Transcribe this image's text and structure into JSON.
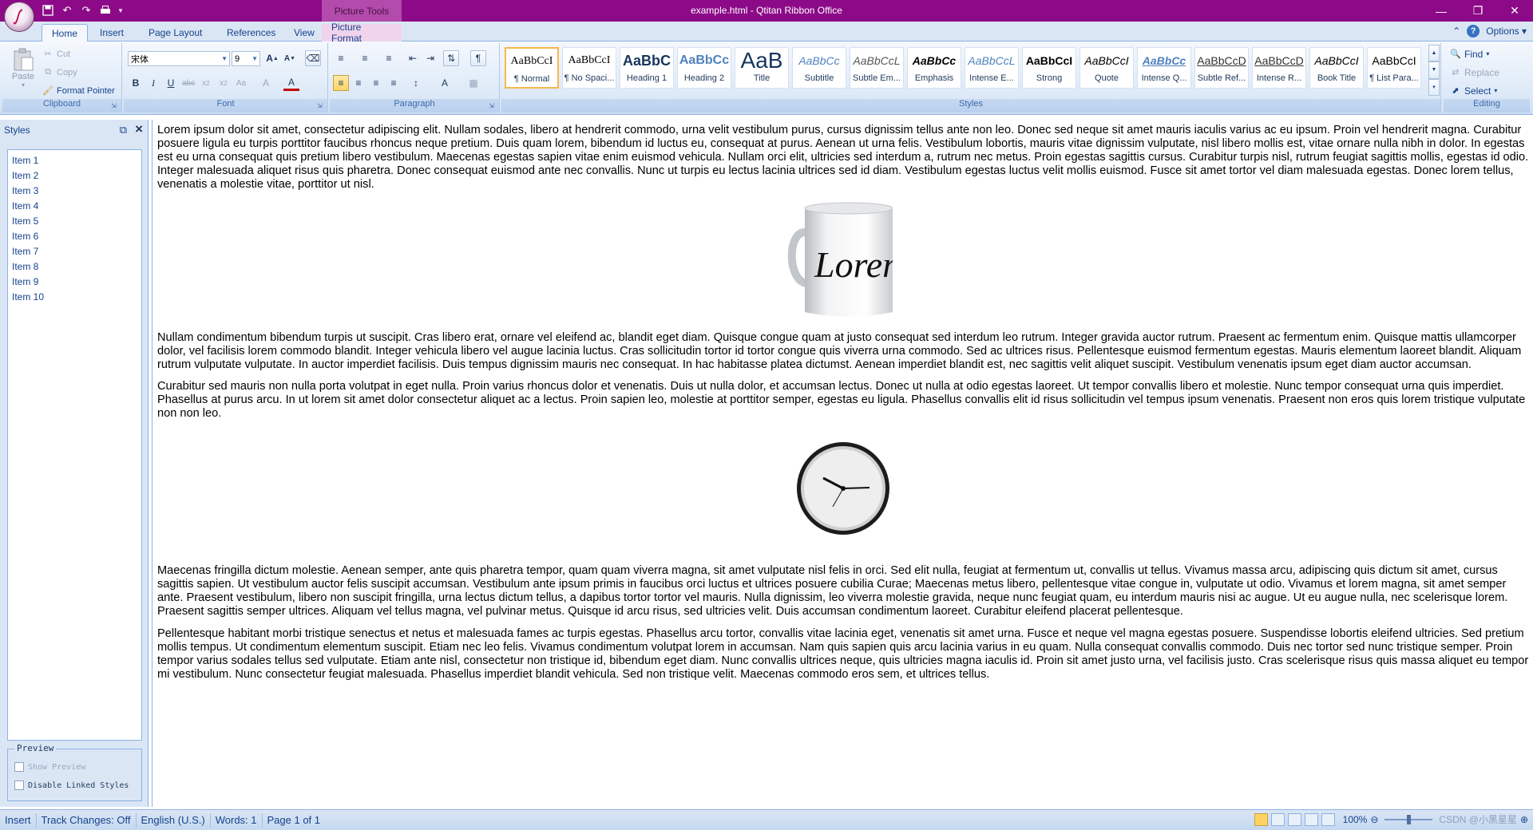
{
  "titlebar": {
    "window_title": "example.html - Qtitan Ribbon Office",
    "contextual_group": "Picture Tools",
    "colors": {
      "background": "#8c0a87",
      "contextual": "#b24bab"
    }
  },
  "qat": [
    "save-icon",
    "undo-icon",
    "redo-icon",
    "print-icon",
    "customize-arrow-icon"
  ],
  "tabs": [
    {
      "label": "Home"
    },
    {
      "label": "Insert"
    },
    {
      "label": "Page Layout"
    },
    {
      "label": "References"
    },
    {
      "label": "View"
    },
    {
      "label": "Picture Format"
    }
  ],
  "options_label": "Options",
  "clipboard": {
    "label": "Clipboard",
    "paste": "Paste",
    "cut": "Cut",
    "copy": "Copy",
    "format_pointer": "Format Pointer"
  },
  "font": {
    "label": "Font",
    "family": "宋体",
    "size": "9"
  },
  "paragraph": {
    "label": "Paragraph"
  },
  "styles_group": {
    "label": "Styles",
    "items": [
      {
        "sample": "AaBbCcI",
        "name": "¶ Normal"
      },
      {
        "sample": "AaBbCcI",
        "name": "¶ No Spaci..."
      },
      {
        "sample": "AaBbC",
        "name": "Heading 1"
      },
      {
        "sample": "AaBbCc",
        "name": "Heading 2"
      },
      {
        "sample": "AaB",
        "name": "Title"
      },
      {
        "sample": "AaBbCc",
        "name": "Subtitle"
      },
      {
        "sample": "AaBbCcL",
        "name": "Subtle Em..."
      },
      {
        "sample": "AaBbCc",
        "name": "Emphasis"
      },
      {
        "sample": "AaBbCcL",
        "name": "Intense E..."
      },
      {
        "sample": "AaBbCcI",
        "name": "Strong"
      },
      {
        "sample": "AaBbCcI",
        "name": "Quote"
      },
      {
        "sample": "AaBbCc",
        "name": "Intense Q..."
      },
      {
        "sample": "AaBbCcD",
        "name": "Subtle Ref..."
      },
      {
        "sample": "AaBbCcD",
        "name": "Intense R..."
      },
      {
        "sample": "AaBbCcI",
        "name": "Book Title"
      },
      {
        "sample": "AaBbCcI",
        "name": "¶ List Para..."
      }
    ]
  },
  "editing": {
    "label": "Editing",
    "find": "Find",
    "replace": "Replace",
    "select": "Select"
  },
  "styles_panel": {
    "title": "Styles",
    "items": [
      "Item 1",
      "Item 2",
      "Item 3",
      "Item 4",
      "Item 5",
      "Item 6",
      "Item 7",
      "Item 8",
      "Item 9",
      "Item 10"
    ],
    "preview_label": "Preview",
    "show_preview": "Show Preview",
    "disable_linked": "Disable Linked Styles"
  },
  "document": {
    "p1": "Lorem ipsum dolor sit amet, consectetur adipiscing elit. Nullam sodales, libero at hendrerit commodo, urna velit vestibulum purus, cursus dignissim tellus ante non leo. Donec sed neque sit amet mauris iaculis varius ac eu ipsum. Proin vel hendrerit magna. Curabitur posuere ligula eu turpis porttitor faucibus rhoncus neque pretium. Duis quam lorem, bibendum id luctus eu, consequat at purus. Aenean ut urna felis. Vestibulum lobortis, mauris vitae dignissim vulputate, nisl libero mollis est, vitae ornare nulla nibh in dolor. In egestas est eu urna consequat quis pretium libero vestibulum. Maecenas egestas sapien vitae enim euismod vehicula. Nullam orci elit, ultricies sed interdum a, rutrum nec metus. Proin egestas sagittis cursus. Curabitur turpis nisl, rutrum feugiat sagittis mollis, egestas id odio. Integer malesuada aliquet risus quis pharetra. Donec consequat euismod ante nec convallis. Nunc ut turpis eu lectus lacinia ultrices sed id diam. Vestibulum egestas luctus velit mollis euismod. Fusce sit amet tortor vel diam malesuada egestas. Donec lorem tellus, venenatis a molestie vitae, porttitor ut nisl.",
    "mug_text": "Lorem",
    "p2": "Nullam condimentum bibendum turpis ut suscipit. Cras libero erat, ornare vel eleifend ac, blandit eget diam. Quisque congue quam at justo consequat sed interdum leo rutrum. Integer gravida auctor rutrum. Praesent ac fermentum enim. Quisque mattis ullamcorper dolor, vel facilisis lorem commodo blandit. Integer vehicula libero vel augue lacinia luctus. Cras sollicitudin tortor id tortor congue quis viverra urna commodo. Sed ac ultrices risus. Pellentesque euismod fermentum egestas. Mauris elementum laoreet blandit. Aliquam rutrum vulputate vulputate. In auctor imperdiet facilisis. Duis tempus dignissim mauris nec consequat. In hac habitasse platea dictumst. Aenean imperdiet blandit est, nec sagittis velit aliquet suscipit. Vestibulum venenatis ipsum eget diam auctor accumsan.",
    "p3": "Curabitur sed mauris non nulla porta volutpat in eget nulla. Proin varius rhoncus dolor et venenatis. Duis ut nulla dolor, et accumsan lectus. Donec ut nulla at odio egestas laoreet. Ut tempor convallis libero et molestie. Nunc tempor consequat urna quis imperdiet. Phasellus at purus arcu. In ut lorem sit amet dolor consectetur aliquet ac a lectus. Proin sapien leo, molestie at porttitor semper, egestas eu ligula. Phasellus convallis elit id risus sollicitudin vel tempus ipsum venenatis. Praesent non eros quis lorem tristique vulputate non non leo.",
    "p4": "Maecenas fringilla dictum molestie. Aenean semper, ante quis pharetra tempor, quam quam viverra magna, sit amet vulputate nisl felis in orci. Sed elit nulla, feugiat at fermentum ut, convallis ut tellus. Vivamus massa arcu, adipiscing quis dictum sit amet, cursus sagittis sapien. Ut vestibulum auctor felis suscipit accumsan. Vestibulum ante ipsum primis in faucibus orci luctus et ultrices posuere cubilia Curae; Maecenas metus libero, pellentesque vitae congue in, vulputate ut odio. Vivamus et lorem magna, sit amet semper ante. Praesent vestibulum, libero non suscipit fringilla, urna lectus dictum tellus, a dapibus tortor tortor vel mauris. Nulla dignissim, leo viverra molestie gravida, neque nunc feugiat quam, eu interdum mauris nisi ac augue. Ut eu augue nulla, nec scelerisque lorem. Praesent sagittis semper ultrices. Aliquam vel tellus magna, vel pulvinar metus. Quisque id arcu risus, sed ultricies velit. Duis accumsan condimentum laoreet. Curabitur eleifend placerat pellentesque.",
    "p5": "Pellentesque habitant morbi tristique senectus et netus et malesuada fames ac turpis egestas. Phasellus arcu tortor, convallis vitae lacinia eget, venenatis sit amet urna. Fusce et neque vel magna egestas posuere. Suspendisse lobortis eleifend ultricies. Sed pretium mollis tempus. Ut condimentum elementum suscipit. Etiam nec leo felis. Vivamus condimentum volutpat lorem in accumsan. Nam quis sapien quis arcu lacinia varius in eu quam. Nulla consequat convallis commodo. Duis nec tortor sed nunc tristique semper. Proin tempor varius sodales tellus sed vulputate. Etiam ante nisl, consectetur non tristique id, bibendum eget diam. Nunc convallis ultrices neque, quis ultricies magna iaculis id. Proin sit amet justo urna, vel facilisis justo. Cras scelerisque risus quis massa aliquet eu tempor mi vestibulum. Nunc consectetur feugiat malesuada. Phasellus imperdiet blandit vehicula. Sed non tristique velit. Maecenas commodo eros sem, et ultrices tellus."
  },
  "statusbar": {
    "mode": "Insert",
    "track_changes": "Track Changes: Off",
    "language": "English (U.S.)",
    "words": "Words: 1",
    "page": "Page 1 of 1",
    "zoom": "100%",
    "watermark": "CSDN @小黑星星"
  }
}
